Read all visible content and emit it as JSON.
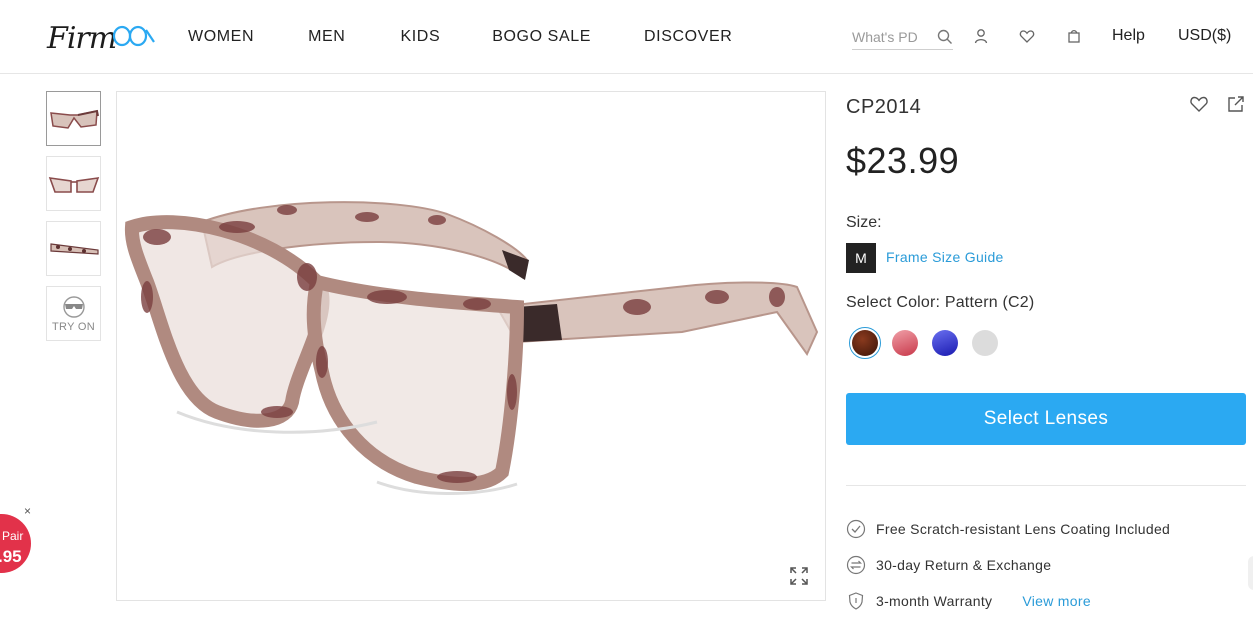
{
  "header": {
    "logo_text": "Firm",
    "nav": [
      "WOMEN",
      "MEN",
      "KIDS",
      "BOGO SALE",
      "DISCOVER"
    ],
    "search_placeholder": "What's PD",
    "help_label": "Help",
    "currency_label": "USD($)"
  },
  "gallery": {
    "tryon_label": "TRY ON"
  },
  "product": {
    "title": "CP2014",
    "price": "$23.99",
    "size_label": "Size:",
    "size_value": "M",
    "size_guide_label": "Frame Size Guide",
    "color_label": "Select Color: Pattern (C2)",
    "swatches": [
      {
        "name": "Pattern (C2)",
        "color": "#6b2a14",
        "selected": true
      },
      {
        "name": "Red",
        "color": "#d8606c"
      },
      {
        "name": "Blue",
        "color": "#2a2fd0"
      },
      {
        "name": "Clear",
        "color": "#dedede"
      }
    ],
    "cta_label": "Select Lenses",
    "features": [
      {
        "icon": "check-circle-icon",
        "text": "Free Scratch-resistant Lens Coating Included"
      },
      {
        "icon": "exchange-icon",
        "text": "30-day Return & Exchange"
      },
      {
        "icon": "shield-icon",
        "text": "3-month Warranty"
      }
    ],
    "view_more_label": "View more"
  },
  "promo": {
    "line1": "Pair",
    "line2": ".95",
    "close": "×"
  },
  "colors": {
    "accent": "#2ba9f2",
    "link": "#2a9bd8",
    "promo": "#e2324a"
  }
}
